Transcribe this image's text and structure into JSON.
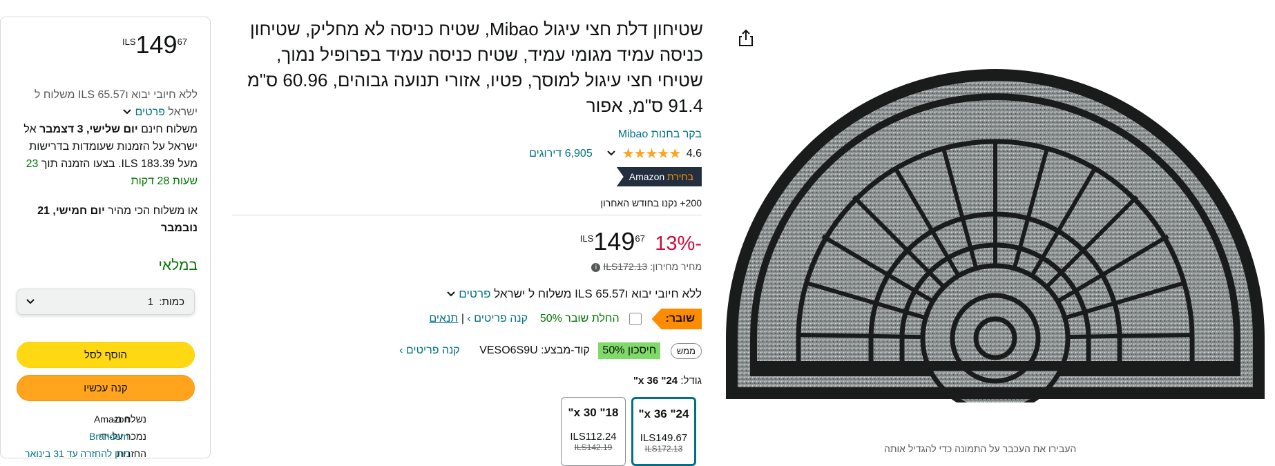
{
  "buybox": {
    "price": {
      "currency": "ILS",
      "whole": "149",
      "fraction": "67"
    },
    "shipping_import_prefix": "ללא חיובי יבוא ו",
    "shipping_import_amount": "ILS 65.57",
    "shipping_import_suffix": "משלוח ל",
    "shipping_country": "ישראל",
    "details_link": "פרטים",
    "free_delivery_prefix": "משלוח חינם",
    "free_delivery_date": "יום שלישי, 3 דצמבר",
    "free_delivery_suffix": "אל ישראל על הזמנות שעומדות בדרישות מעל ILS 183.39. בצעו הזמנה תוך",
    "countdown": "23 שעות 28 דקות",
    "fastest_prefix": "או משלוח הכי מהיר",
    "fastest_date": "יום חמישי, 21 נובמבר",
    "in_stock": "במלאי",
    "quantity_label": "כמות:",
    "quantity_value": "1",
    "add_to_cart": "הוסף לסל",
    "buy_now": "קנה עכשיו",
    "ships_from_label": "נשלח מ-",
    "ships_from_value": "Amazon",
    "sold_by_label": "נמכר על-ידי",
    "sold_by_value": "Brandern",
    "returns_label": "החזרות",
    "returns_value": "ניתן להחזרה עד 31 בינואר"
  },
  "product": {
    "title": "שטיחון דלת חצי עיגול Mibao, שטיח כניסה לא מחליק, שטיחון כניסה עמיד מגומי עמיד, שטיח כניסה עמיד בפרופיל נמוך, שטיחי חצי עיגול למוסך, פטיו, אזורי תנועה גבוהים, 60.96 ס\"מ 91.4 ס\"מ, אפור",
    "store_link": "בקר בחנות Mibao",
    "rating": "4.6",
    "stars_display": "★★★★★",
    "ratings_count": "6,905 דירוגים",
    "choice_prefix": "Amazon",
    "choice_highlight": "בחירת",
    "bought_past_month": "200+ נקנו בחודש האחרון",
    "discount": "-13%",
    "price": {
      "currency": "ILS",
      "whole": "149",
      "fraction": "67"
    },
    "list_price_label": "מחיר מחירון:",
    "list_price": "ILS172.13",
    "shipping_line_prefix": "ללא חיובי יבוא ו",
    "shipping_line_amount": "ILS 65.57",
    "shipping_line_suffix": "משלוח ל ישראל",
    "shipping_details": "פרטים",
    "coupon_tag": "שובר:",
    "coupon_apply": "החלת שובר 50%",
    "coupon_shop": "קנה פריטים ›",
    "coupon_sep": "|",
    "coupon_terms": "תנאים",
    "promo_badge": "ממש",
    "promo_save": "חיסכון 50%",
    "promo_code_label": "קוד-מבצע:",
    "promo_code": "VESO6S9U",
    "promo_shop": "קנה פריטים ›",
    "size_label": "גודל:",
    "size_selected": "24\" 36 x\"",
    "sizes": [
      {
        "label": "24\" 36 x\"",
        "price": "ILS149.67",
        "old_price": "ILS172.13"
      },
      {
        "label": "18\" 30 x\"",
        "price": "ILS112.24",
        "old_price": "ILS142.19"
      }
    ]
  },
  "gallery": {
    "share_icon": "share-icon",
    "caption": "העבירו את העכבר על התמונה כדי להגדיל אותה"
  },
  "colors": {
    "accent_link": "#007185",
    "deal_red": "#CC0C39",
    "in_stock_green": "#007600",
    "cart_yellow": "#FFD814",
    "buy_orange": "#FFA41C",
    "coupon_orange": "#FF8B00",
    "save_green": "#7FDA69",
    "choice_dark": "#232F3E"
  }
}
